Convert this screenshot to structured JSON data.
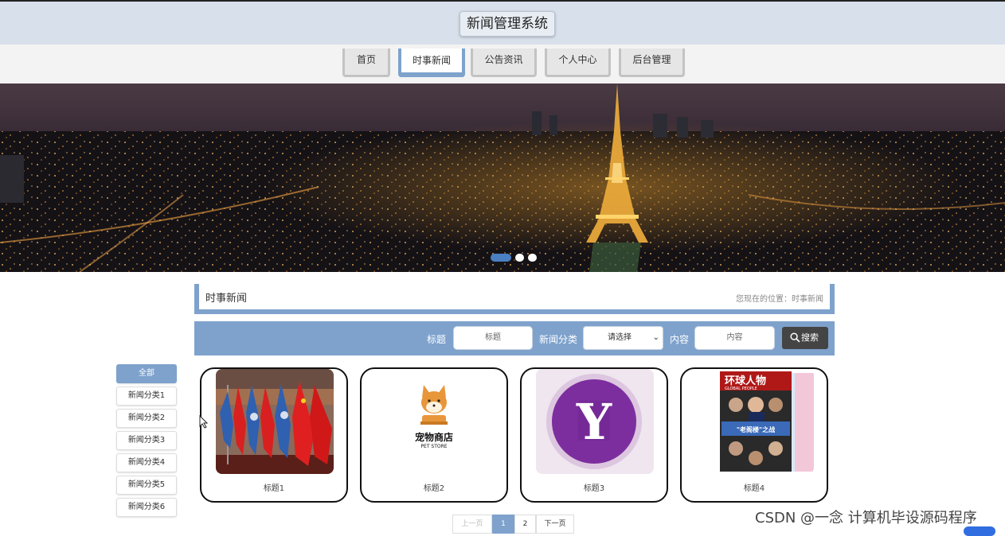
{
  "header": {
    "title": "新闻管理系统"
  },
  "nav": {
    "items": [
      {
        "label": "首页"
      },
      {
        "label": "时事新闻"
      },
      {
        "label": "公告资讯"
      },
      {
        "label": "个人中心"
      },
      {
        "label": "后台管理"
      }
    ],
    "active_index": 1
  },
  "banner": {
    "slides": 3,
    "active_slide": 0
  },
  "section": {
    "title": "时事新闻",
    "location": "您现在的位置：时事新闻"
  },
  "search": {
    "title_label": "标题",
    "title_placeholder": "标题",
    "category_label": "新闻分类",
    "category_value": "请选择",
    "content_label": "内容",
    "content_placeholder": "内容",
    "button_label": "搜索"
  },
  "categories": [
    {
      "label": "全部"
    },
    {
      "label": "新闻分类1"
    },
    {
      "label": "新闻分类2"
    },
    {
      "label": "新闻分类3"
    },
    {
      "label": "新闻分类4"
    },
    {
      "label": "新闻分类5"
    },
    {
      "label": "新闻分类6"
    }
  ],
  "cards": [
    {
      "title": "标题1",
      "image": "flags-photo"
    },
    {
      "title": "标题2",
      "image": "pet-store-logo",
      "logo_text": "宠物商店",
      "logo_sub": "PET STORE"
    },
    {
      "title": "标题3",
      "image": "yahoo-logo",
      "logo_letter": "Y"
    },
    {
      "title": "标题4",
      "image": "magazine-cover",
      "mag_title": "环球人物",
      "mag_sub": "GLOBAL PEOPLE",
      "mag_headline": "\"老阁楼\"之战"
    }
  ],
  "pagination": {
    "prev": "上一页",
    "pages": [
      "1",
      "2"
    ],
    "current": "1",
    "next": "下一页"
  },
  "watermark": "CSDN @一念 计算机毕设源码程序",
  "colors": {
    "accent": "#7ea2cc",
    "header_bg": "#d8e0eb",
    "search_btn": "#444444"
  }
}
